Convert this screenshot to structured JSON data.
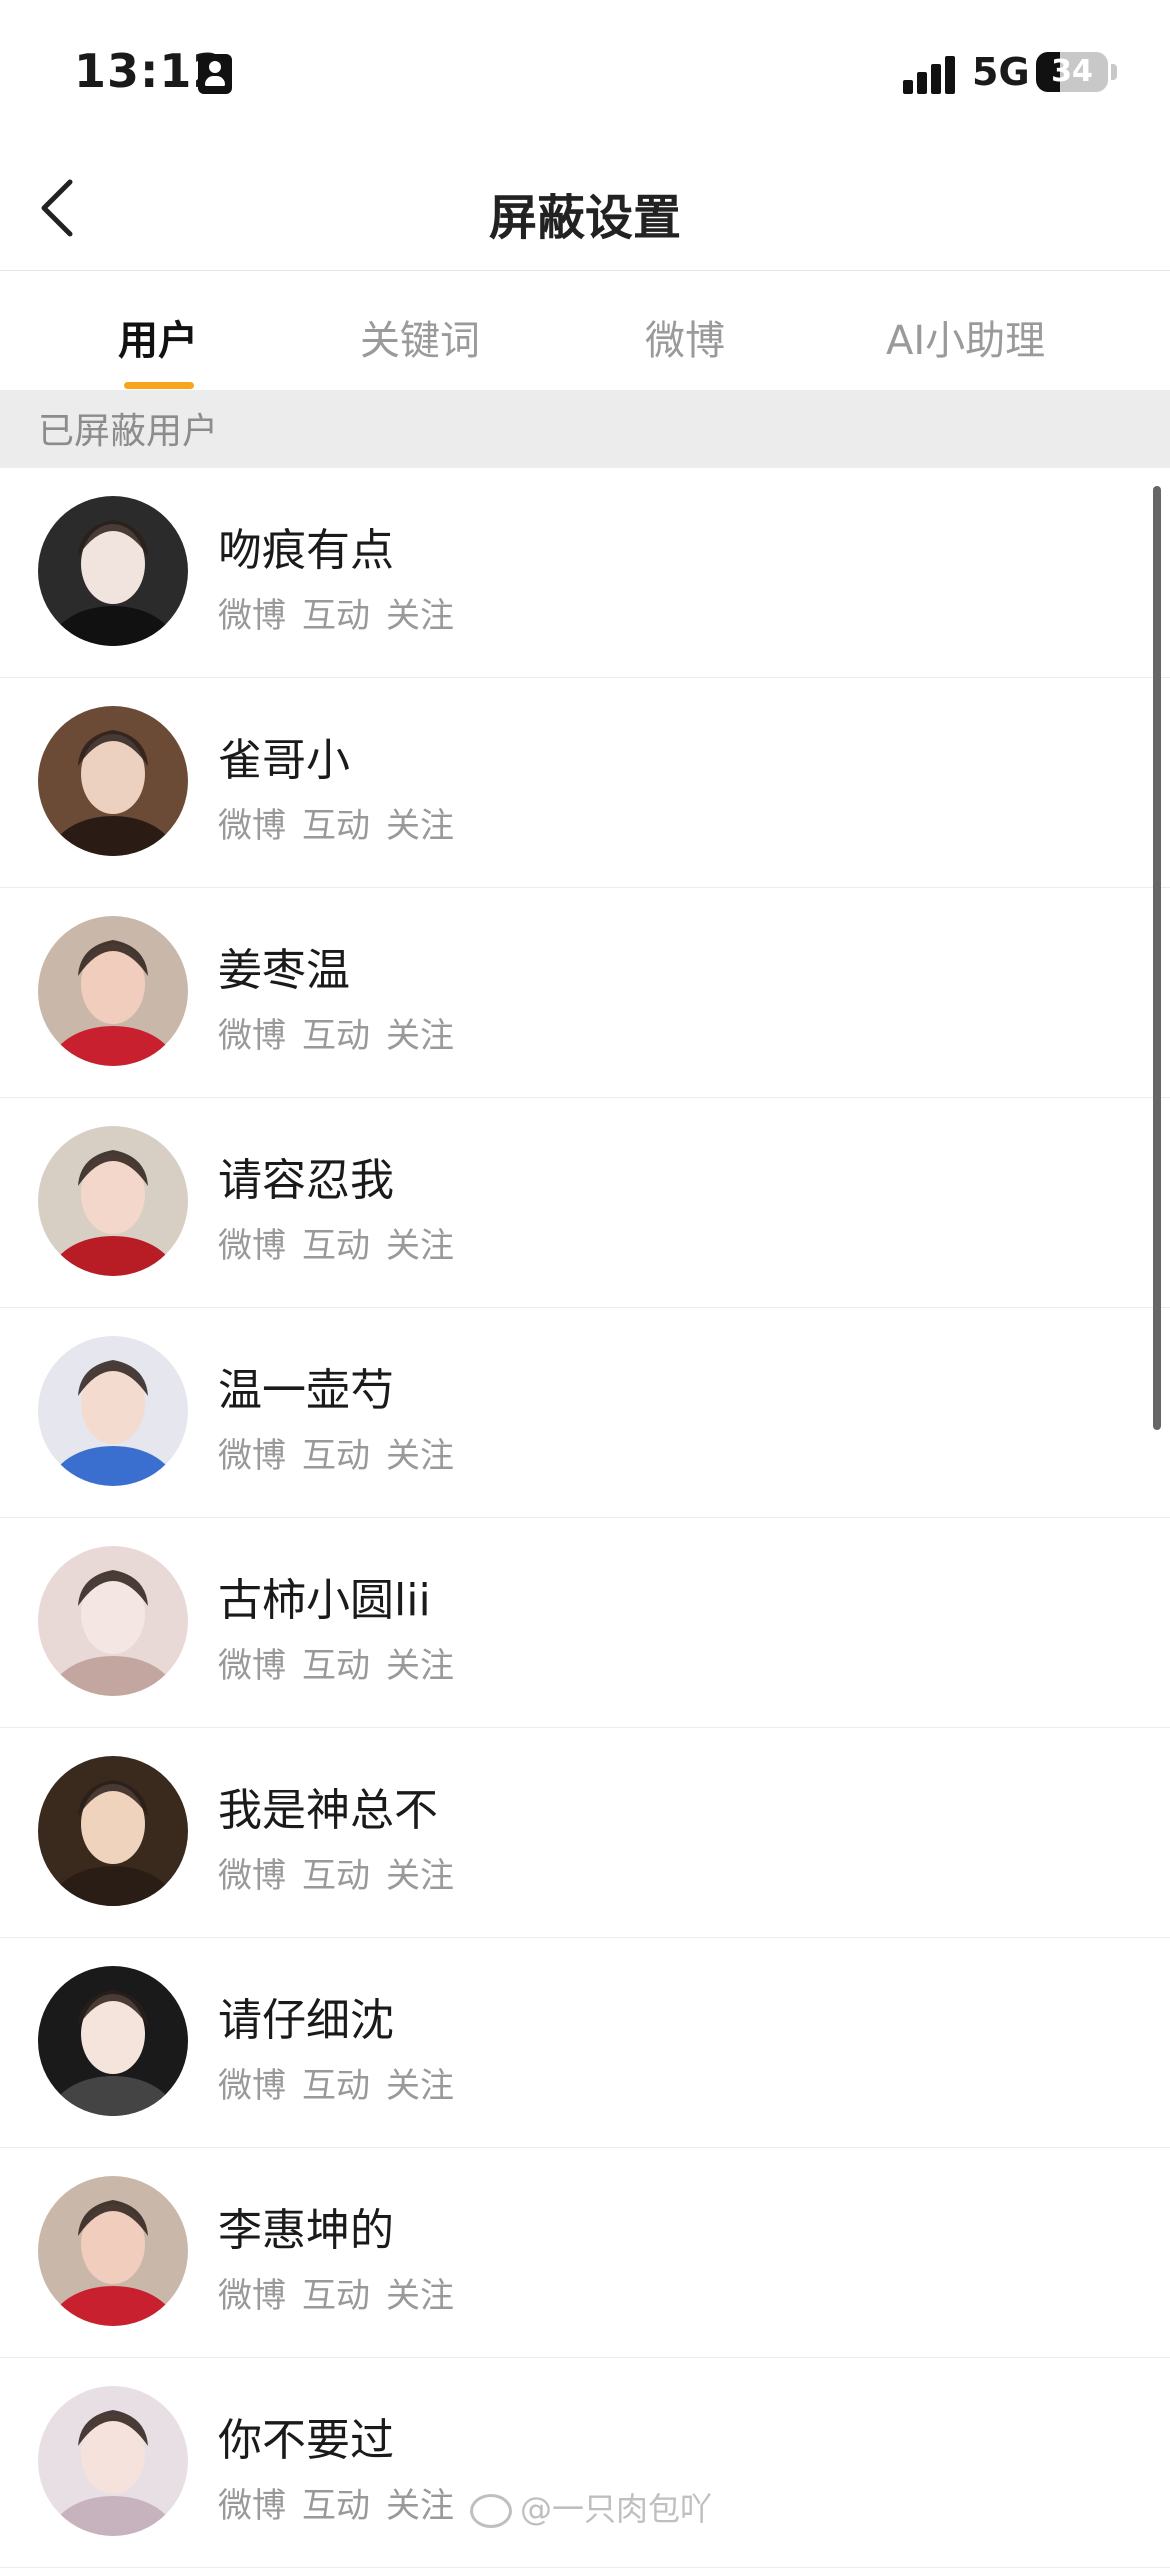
{
  "status_bar": {
    "time": "13:12",
    "network": "5G",
    "battery": "34",
    "battery_level": 0.34
  },
  "nav": {
    "back_icon": "chevron-left-icon",
    "title": "屏蔽设置"
  },
  "tabs": [
    {
      "label": "用户",
      "active": true
    },
    {
      "label": "关键词",
      "active": false
    },
    {
      "label": "微博",
      "active": false
    },
    {
      "label": "AI小助理",
      "active": false
    }
  ],
  "section_label": "已屏蔽用户",
  "users": [
    {
      "name": "吻痕有点",
      "actions": [
        "微博",
        "互动",
        "关注"
      ]
    },
    {
      "name": "雀哥小",
      "actions": [
        "微博",
        "互动",
        "关注"
      ]
    },
    {
      "name": "姜枣温",
      "actions": [
        "微博",
        "互动",
        "关注"
      ]
    },
    {
      "name": "请容忍我",
      "actions": [
        "微博",
        "互动",
        "关注"
      ]
    },
    {
      "name": "温一壶芍",
      "actions": [
        "微博",
        "互动",
        "关注"
      ]
    },
    {
      "name": "古柿小圆lii",
      "actions": [
        "微博",
        "互动",
        "关注"
      ]
    },
    {
      "name": "我是神总不",
      "actions": [
        "微博",
        "互动",
        "关注"
      ]
    },
    {
      "name": "请仔细沈",
      "actions": [
        "微博",
        "互动",
        "关注"
      ]
    },
    {
      "name": "李惠坤的",
      "actions": [
        "微博",
        "互动",
        "关注"
      ]
    },
    {
      "name": "你不要过",
      "actions": [
        "微博",
        "互动",
        "关注"
      ]
    }
  ],
  "watermark": "@一只肉包吖",
  "colors": {
    "accent": "#f7a51c",
    "section_bg": "#ececec",
    "muted_text": "#999999"
  }
}
